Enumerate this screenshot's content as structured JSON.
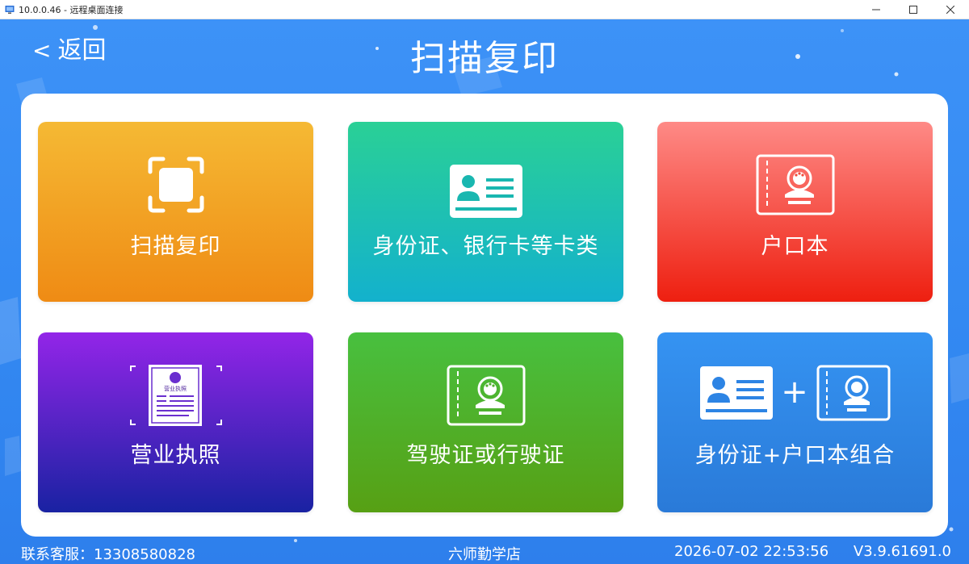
{
  "window": {
    "title": "10.0.0.46 - 远程桌面连接",
    "controls": [
      "minimize",
      "maximize",
      "close"
    ]
  },
  "header": {
    "back_chevron": "<",
    "back_label": "返回",
    "title": "扫描复印"
  },
  "cards": [
    {
      "label": "扫描复印",
      "icon": "scan-frame-icon",
      "color_top": "#f5b934",
      "color_bottom": "#ef8b14"
    },
    {
      "label": "身份证、银行卡等卡类",
      "icon": "id-card-icon",
      "color_top": "#2ad096",
      "color_bottom": "#13b1cd"
    },
    {
      "label": "户口本",
      "icon": "household-register-icon",
      "color_top": "#fe8a86",
      "color_bottom": "#ee1f10"
    },
    {
      "label": "营业执照",
      "icon": "business-license-icon",
      "icon_text": "营业执照",
      "color_top": "#9325e8",
      "color_bottom": "#1922a2"
    },
    {
      "label": "驾驶证或行驶证",
      "icon": "driver-license-icon",
      "color_top": "#48c03f",
      "color_bottom": "#57a014"
    },
    {
      "label": "身份证+户口本组合",
      "icon": "id-plus-household-icon",
      "plus": "+",
      "color_top": "#3593f2",
      "color_bottom": "#2a7ad8"
    }
  ],
  "footer": {
    "contact": "联系客服：13308580828",
    "store": "六师勤学店",
    "datetime": "2026-07-02 22:53:56",
    "version": "V3.9.61691.0"
  }
}
